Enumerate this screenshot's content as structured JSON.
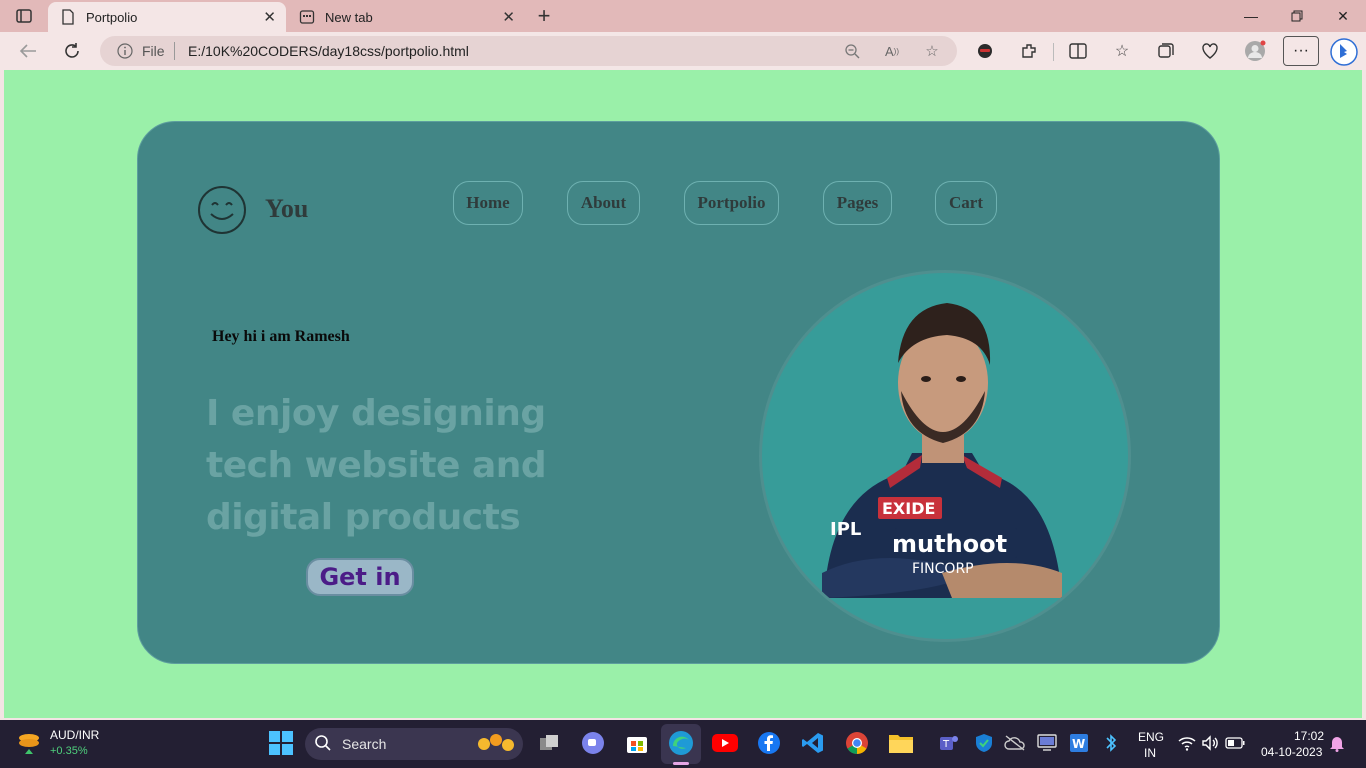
{
  "browser": {
    "tabs": [
      {
        "title": "Portpolio",
        "active": true
      },
      {
        "title": "New tab",
        "active": false
      }
    ],
    "address": {
      "scheme_label": "File",
      "url": "E:/10K%20CODERS/day18css/portpolio.html"
    }
  },
  "page": {
    "logo_text": "You",
    "nav": [
      "Home",
      "About",
      "Portpolio",
      "Pages",
      "Cart"
    ],
    "greeting": "Hey hi i am Ramesh",
    "headline": "I enjoy designing tech website and digital products",
    "cta_label": "Get in",
    "photo_text": {
      "sponsor1": "EXIDE",
      "sponsor2": "muthoot",
      "sponsor3": "FINCORP",
      "league": "IPL"
    },
    "colors": {
      "background": "#9af0a9",
      "card": "#428686",
      "photo_circle": "#379c99",
      "headline": "#6aa3a3",
      "cta_text": "#4b1c87"
    }
  },
  "taskbar": {
    "ticker_label": "AUD/INR",
    "ticker_change": "+0.35%",
    "search_placeholder": "Search",
    "lang_line1": "ENG",
    "lang_line2": "IN",
    "time": "17:02",
    "date": "04-10-2023"
  }
}
